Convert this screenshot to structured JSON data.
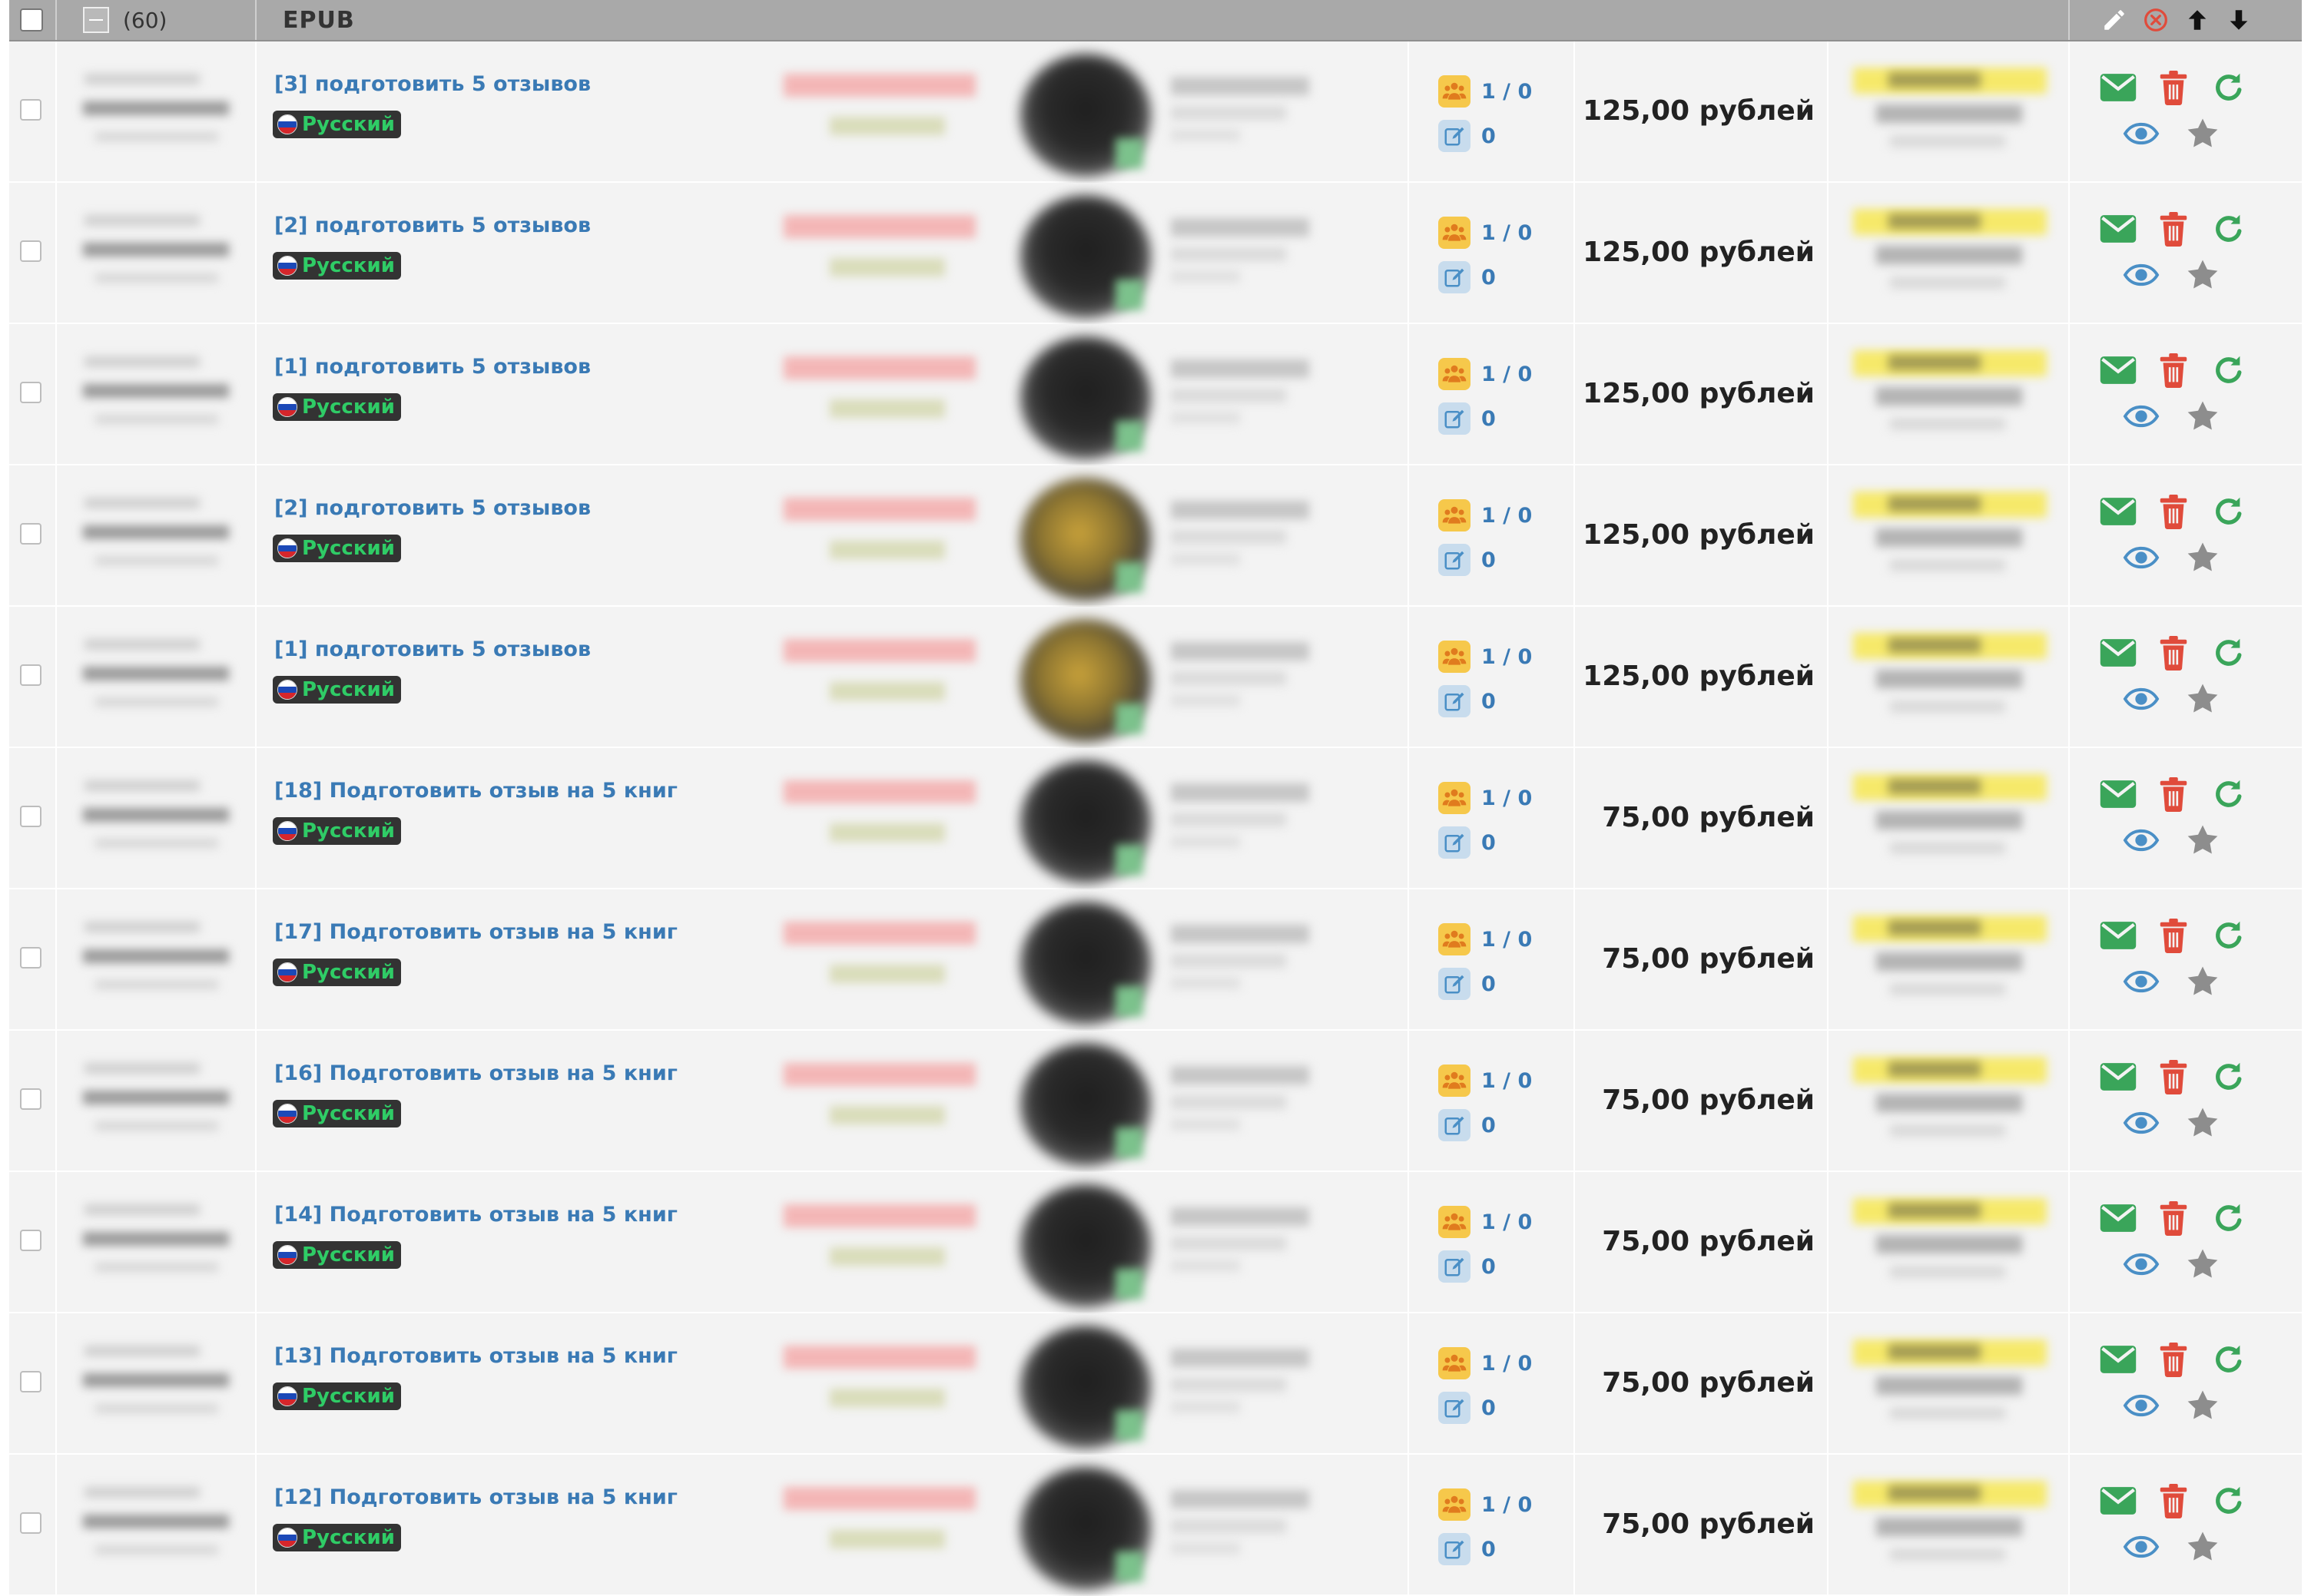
{
  "header": {
    "count": "(60)",
    "title": "EPUB"
  },
  "rows": [
    {
      "title": "[3] подготовить 5 отзывов",
      "lang": "Русский",
      "people": "1 / 0",
      "edits": "0",
      "price": "125,00 рублей",
      "avatar": "dark"
    },
    {
      "title": "[2] подготовить 5 отзывов",
      "lang": "Русский",
      "people": "1 / 0",
      "edits": "0",
      "price": "125,00 рублей",
      "avatar": "dark"
    },
    {
      "title": "[1] подготовить 5 отзывов",
      "lang": "Русский",
      "people": "1 / 0",
      "edits": "0",
      "price": "125,00 рублей",
      "avatar": "dark"
    },
    {
      "title": "[2] подготовить 5 отзывов",
      "lang": "Русский",
      "people": "1 / 0",
      "edits": "0",
      "price": "125,00 рублей",
      "avatar": "gold"
    },
    {
      "title": "[1] подготовить 5 отзывов",
      "lang": "Русский",
      "people": "1 / 0",
      "edits": "0",
      "price": "125,00 рублей",
      "avatar": "gold"
    },
    {
      "title": "[18] Подготовить отзыв на 5 книг",
      "lang": "Русский",
      "people": "1 / 0",
      "edits": "0",
      "price": "75,00 рублей",
      "avatar": "dark"
    },
    {
      "title": "[17] Подготовить отзыв на 5 книг",
      "lang": "Русский",
      "people": "1 / 0",
      "edits": "0",
      "price": "75,00 рублей",
      "avatar": "dark"
    },
    {
      "title": "[16] Подготовить отзыв на 5 книг",
      "lang": "Русский",
      "people": "1 / 0",
      "edits": "0",
      "price": "75,00 рублей",
      "avatar": "dark"
    },
    {
      "title": "[14] Подготовить отзыв на 5 книг",
      "lang": "Русский",
      "people": "1 / 0",
      "edits": "0",
      "price": "75,00 рублей",
      "avatar": "dark"
    },
    {
      "title": "[13] Подготовить отзыв на 5 книг",
      "lang": "Русский",
      "people": "1 / 0",
      "edits": "0",
      "price": "75,00 рублей",
      "avatar": "dark"
    },
    {
      "title": "[12] Подготовить отзыв на 5 книг",
      "lang": "Русский",
      "people": "1 / 0",
      "edits": "0",
      "price": "75,00 рублей",
      "avatar": "dark"
    }
  ],
  "icons": {
    "header": [
      "pencil-icon",
      "cancel-circle-icon",
      "arrow-up-icon",
      "arrow-down-icon"
    ],
    "counters": [
      "people-icon",
      "edit-icon"
    ],
    "actions": [
      "envelope-icon",
      "trash-icon",
      "refresh-icon",
      "eye-icon",
      "star-icon"
    ]
  },
  "colors": {
    "header_bg": "#a9a9a9",
    "row_bg": "#f3f3f3",
    "link": "#3a7ab5",
    "lang_text": "#2fcc66",
    "lang_bg": "#333333",
    "people_badge": "#f6c84b",
    "edit_badge": "#c8dced",
    "envelope": "#3aa55a",
    "trash": "#e04b3b",
    "refresh": "#3aa55a",
    "eye": "#4a8fc6",
    "star": "#8d8d8d"
  }
}
